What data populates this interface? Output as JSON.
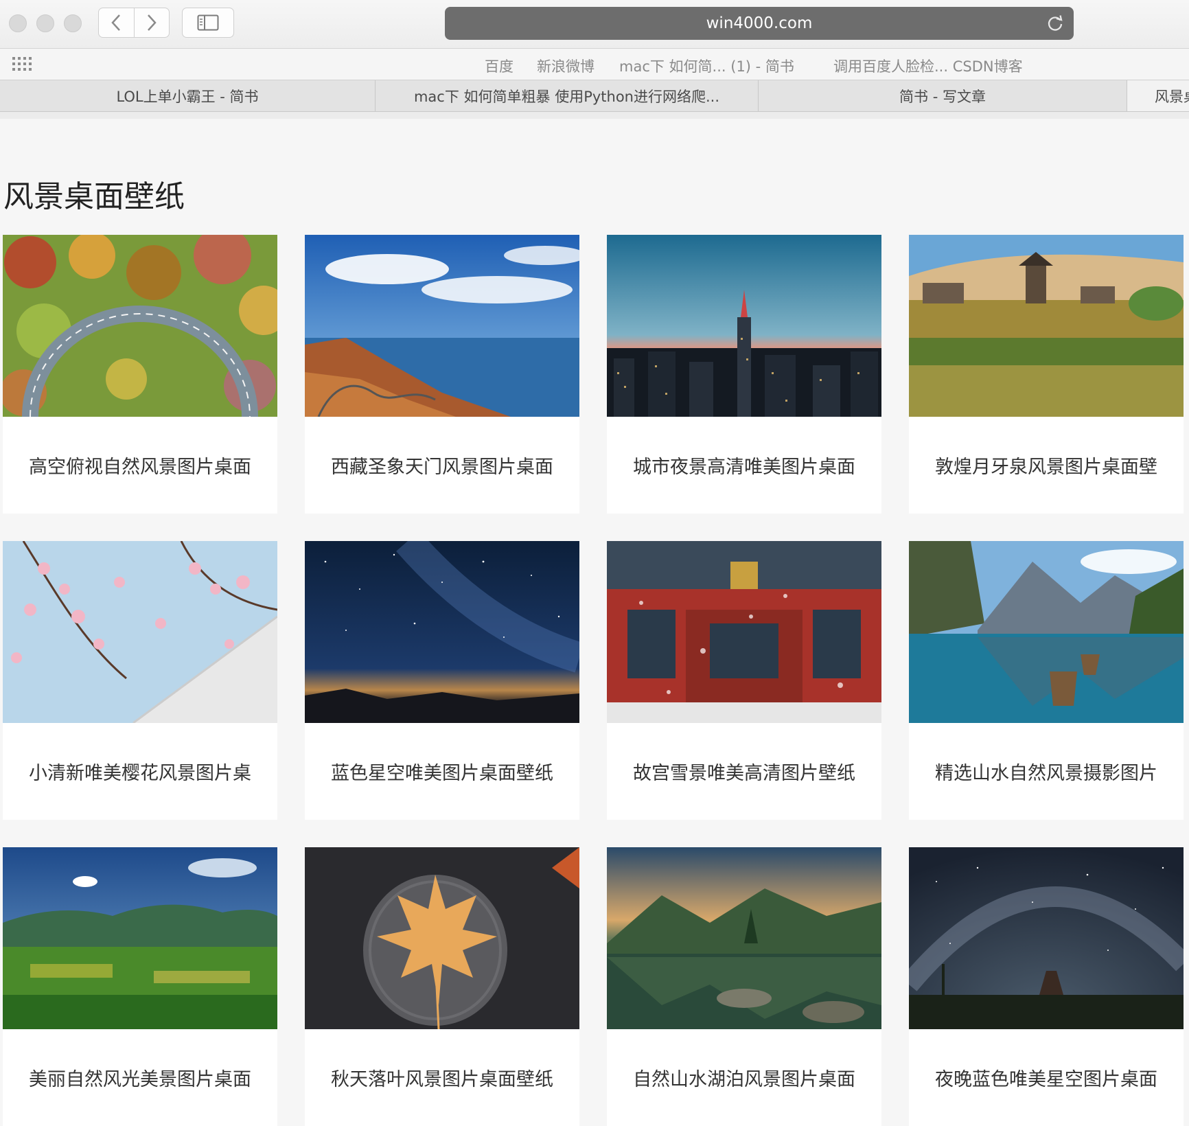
{
  "browser": {
    "url": "win4000.com"
  },
  "favorites": [
    "百度",
    "新浪微博",
    "mac下 如何简... (1) - 简书",
    "调用百度人脸检... CSDN博客"
  ],
  "tabs": [
    "LOL上单小霸王 - 简书",
    "mac下 如何简单粗暴 使用Python进行网络爬...",
    "简书 - 写文章",
    "风景桌"
  ],
  "page": {
    "title": "风景桌面壁纸"
  },
  "wallpapers": [
    {
      "caption": "高空俯视自然风景图片桌面",
      "scene": "forest-road"
    },
    {
      "caption": "西藏圣象天门风景图片桌面",
      "scene": "tibet-lake"
    },
    {
      "caption": "城市夜景高清唯美图片桌面",
      "scene": "city-night"
    },
    {
      "caption": "敦煌月牙泉风景图片桌面壁",
      "scene": "dunhuang"
    },
    {
      "caption": "小清新唯美樱花风景图片桌",
      "scene": "sakura"
    },
    {
      "caption": "蓝色星空唯美图片桌面壁纸",
      "scene": "starry-sky"
    },
    {
      "caption": "故宫雪景唯美高清图片壁纸",
      "scene": "forbidden-city"
    },
    {
      "caption": "精选山水自然风景摄影图片",
      "scene": "mountain-lake"
    },
    {
      "caption": "美丽自然风光美景图片桌面",
      "scene": "green-valley"
    },
    {
      "caption": "秋天落叶风景图片桌面壁纸",
      "scene": "maple-leaf"
    },
    {
      "caption": "自然山水湖泊风景图片桌面",
      "scene": "lake-reflection"
    },
    {
      "caption": "夜晚蓝色唯美星空图片桌面",
      "scene": "milky-way"
    }
  ],
  "colors": {
    "url_bar": "#6d6d6d",
    "page_bg": "#f6f6f6",
    "card_bg": "#ffffff"
  }
}
